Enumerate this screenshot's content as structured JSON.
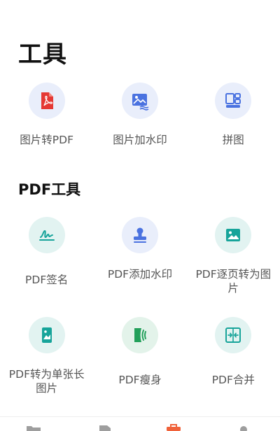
{
  "header": {
    "title": "工具"
  },
  "tools_section": {
    "items": [
      {
        "label": "图片转PDF",
        "icon": "pdf-file-icon"
      },
      {
        "label": "图片加水印",
        "icon": "image-watermark-icon"
      },
      {
        "label": "拼图",
        "icon": "collage-icon"
      }
    ]
  },
  "pdf_section": {
    "title": "PDF工具",
    "items": [
      {
        "label": "PDF签名",
        "icon": "signature-icon"
      },
      {
        "label": "PDF添加水印",
        "icon": "stamp-icon"
      },
      {
        "label": "PDF逐页转为图片",
        "icon": "image-icon"
      },
      {
        "label": "PDF转为单张长图片",
        "icon": "long-image-icon"
      },
      {
        "label": "PDF瘦身",
        "icon": "compress-icon"
      },
      {
        "label": "PDF合并",
        "icon": "merge-icon"
      }
    ]
  },
  "bottom_nav": {
    "items": [
      {
        "icon": "folder-icon"
      },
      {
        "icon": "document-icon"
      },
      {
        "icon": "toolbox-icon",
        "active": true
      },
      {
        "icon": "profile-icon"
      }
    ]
  },
  "colors": {
    "pdf_red": "#e53935",
    "blue": "#4a72e0",
    "teal": "#17a49a",
    "green": "#22a05a",
    "active_orange": "#f0623a"
  }
}
